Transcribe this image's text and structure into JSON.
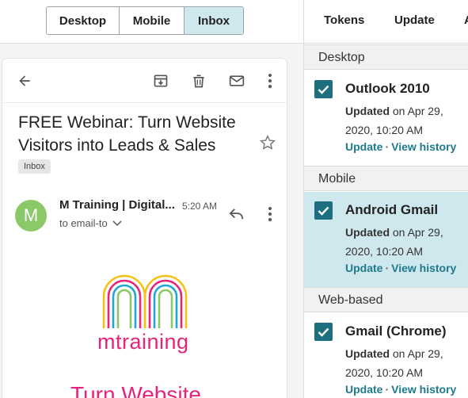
{
  "view_toggle": {
    "options": [
      "Desktop",
      "Mobile",
      "Inbox"
    ],
    "selected": "Inbox"
  },
  "right_tabs": [
    "Tokens",
    "Update",
    "A"
  ],
  "email": {
    "subject": "FREE Webinar: Turn Website Visitors into Leads & Sales",
    "label": "Inbox",
    "avatar_letter": "M",
    "sender": "M Training | Digital...",
    "time": "5:20 AM",
    "to": "to email-to",
    "brand_name": "mtraining",
    "headline_partial": "Turn Website"
  },
  "sections": [
    {
      "heading": "Desktop",
      "clients": [
        {
          "name": "Outlook 2010",
          "updated_label": "Updated",
          "updated_rest": " on Apr 29, 2020, 10:20 AM",
          "link1": "Update",
          "sep": "·",
          "link2": "View history",
          "selected": false
        }
      ]
    },
    {
      "heading": "Mobile",
      "clients": [
        {
          "name": "Android Gmail",
          "updated_label": "Updated",
          "updated_rest": " on Apr 29, 2020, 10:20 AM",
          "link1": "Update",
          "sep": "·",
          "link2": "View history",
          "selected": true
        }
      ]
    },
    {
      "heading": "Web-based",
      "clients": [
        {
          "name": "Gmail (Chrome)",
          "updated_label": "Updated",
          "updated_rest": " on Apr 29, 2020, 10:20 AM",
          "link1": "Update",
          "sep": "·",
          "link2": "View history",
          "selected": false
        }
      ]
    }
  ],
  "colors": {
    "accent": "#1d6f80",
    "link": "#1d7a8c",
    "selected_bg": "#cfe8ee",
    "brand_pink": "#e5247a",
    "avatar_green": "#8bc867"
  },
  "icons": [
    "back-arrow-icon",
    "archive-icon",
    "trash-icon",
    "mail-icon",
    "more-vert-icon",
    "star-icon",
    "reply-icon",
    "chevron-down-icon",
    "checkbox-checked-icon"
  ]
}
